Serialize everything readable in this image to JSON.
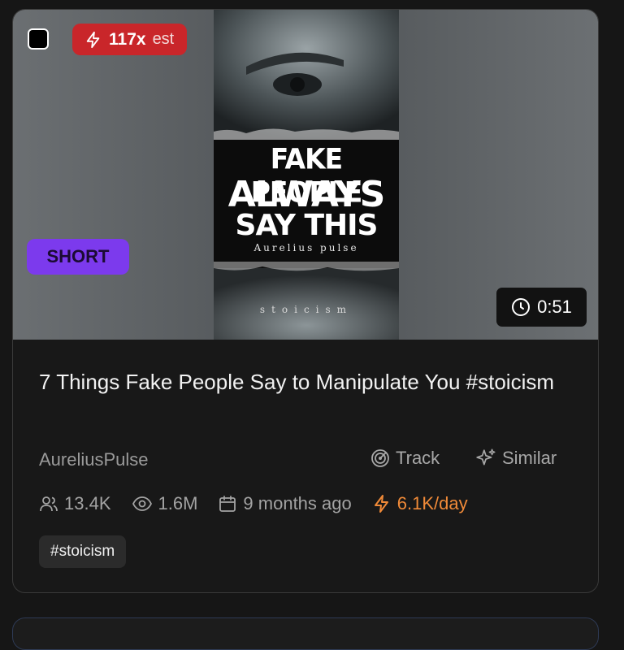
{
  "card": {
    "estimate": {
      "value": "117x",
      "suffix": "est",
      "icon": "bolt-icon"
    },
    "format_badge": "SHORT",
    "duration": "0:51",
    "thumbnail": {
      "headline_lines": [
        "FAKE PEOPLE",
        "ALWAYS",
        "SAY THIS"
      ],
      "brand": "Aurelius pulse",
      "footer": "stoicism"
    },
    "title": "7 Things Fake People Say to Manipulate You #stoicism",
    "channel": "AureliusPulse",
    "actions": {
      "track": "Track",
      "similar": "Similar"
    },
    "stats": {
      "subscribers": "13.4K",
      "views": "1.6M",
      "published": "9 months ago",
      "rate": "6.1K/day"
    },
    "tags": [
      "#stoicism"
    ]
  },
  "colors": {
    "estimate_badge": "#c9262a",
    "short_badge": "#7c3aed",
    "rate_accent": "#f08a38"
  }
}
